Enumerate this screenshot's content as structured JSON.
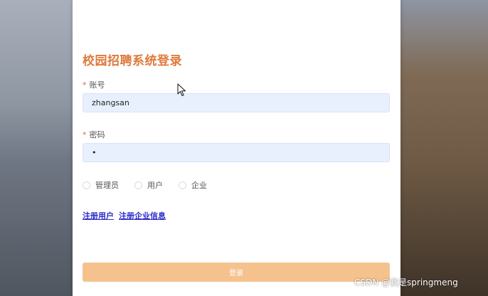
{
  "login": {
    "title": "校园招聘系统登录",
    "account_label": "账号",
    "account_value": "zhangsan",
    "password_label": "密码",
    "password_value": "1",
    "roles": [
      "管理员",
      "用户",
      "企业"
    ],
    "register_user_link": "注册用户",
    "register_company_link": "注册企业信息",
    "login_button": "登录",
    "accent_color": "#e07a3c",
    "button_color": "#f5c28e",
    "field_color": "#e8f0fe"
  },
  "watermark": {
    "text": "CSDN @我是springmeng"
  }
}
